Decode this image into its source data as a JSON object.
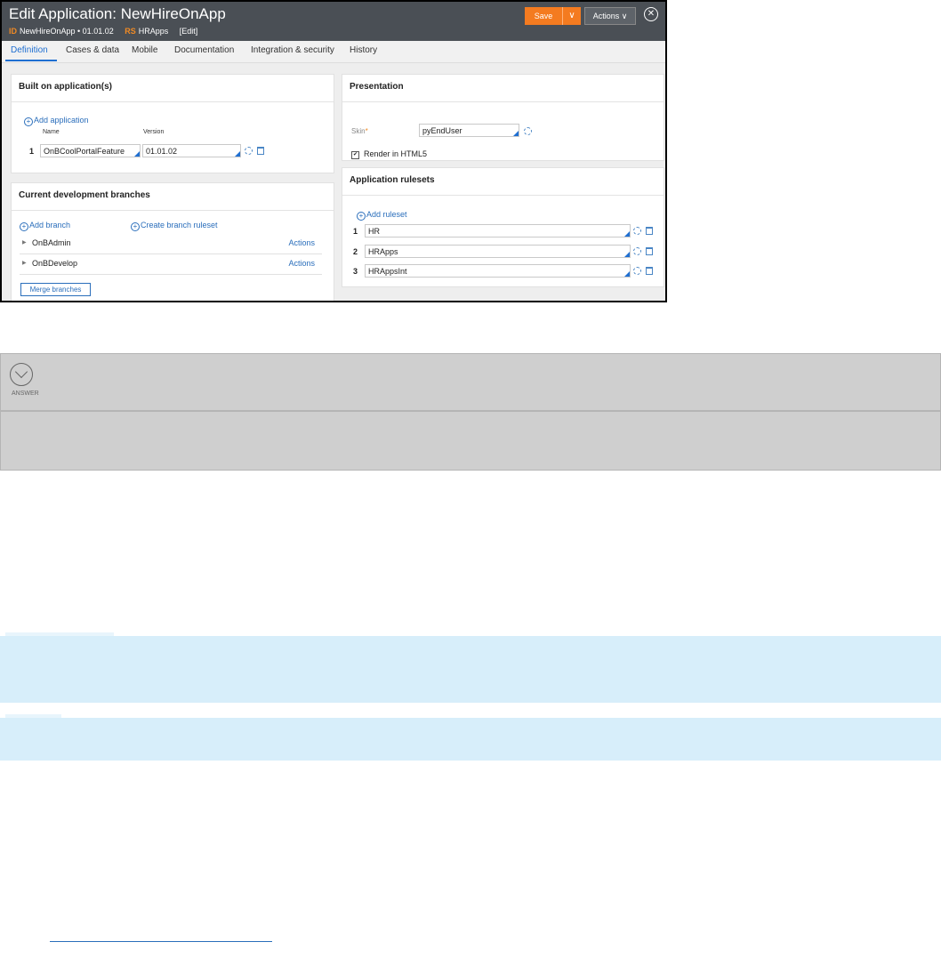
{
  "header": {
    "title": "Edit Application: NewHireOnApp",
    "id_tag": "ID",
    "id_value": "NewHireOnApp • 01.01.02",
    "rs_tag": "RS",
    "rs_value": "HRApps",
    "edit_link": "[Edit]",
    "save_label": "Save",
    "save_dropdown_icon": "chevron-down-icon",
    "actions_label": "Actions ∨",
    "close_icon": "close-icon"
  },
  "tabs": [
    {
      "label": "Definition",
      "active": true
    },
    {
      "label": "Cases & data",
      "active": false
    },
    {
      "label": "Mobile",
      "active": false
    },
    {
      "label": "Documentation",
      "active": false
    },
    {
      "label": "Integration & security",
      "active": false
    },
    {
      "label": "History",
      "active": false
    }
  ],
  "built_on": {
    "title": "Built on application(s)",
    "add_label": "Add application",
    "name_header": "Name",
    "version_header": "Version",
    "rows": [
      {
        "num": "1",
        "name": "OnBCoolPortalFeature",
        "version": "01.01.02"
      }
    ]
  },
  "branches": {
    "title": "Current development branches",
    "add_branch": "Add branch",
    "create_ruleset": "Create branch ruleset",
    "items": [
      {
        "name": "OnBAdmin",
        "actions": "Actions"
      },
      {
        "name": "OnBDevelop",
        "actions": "Actions"
      }
    ],
    "merge_label": "Merge branches"
  },
  "presentation": {
    "title": "Presentation",
    "skin_label": "Skin",
    "required_mark": "*",
    "skin_value": "pyEndUser",
    "render_label": "Render in HTML5",
    "render_checked": true
  },
  "rulesets": {
    "title": "Application rulesets",
    "add_label": "Add ruleset",
    "rows": [
      {
        "num": "1",
        "value": "HR"
      },
      {
        "num": "2",
        "value": "HRApps"
      },
      {
        "num": "3",
        "value": "HRAppsInt"
      }
    ]
  },
  "answer": {
    "label": "ANSWER",
    "icon": "chevron-down-circle-icon"
  },
  "colors": {
    "header_bg": "#4a4f55",
    "accent_orange": "#f47b20",
    "link_blue": "#2a6ebb",
    "note_bg": "#d7eefa",
    "answer_bg": "#cfcfcf"
  }
}
